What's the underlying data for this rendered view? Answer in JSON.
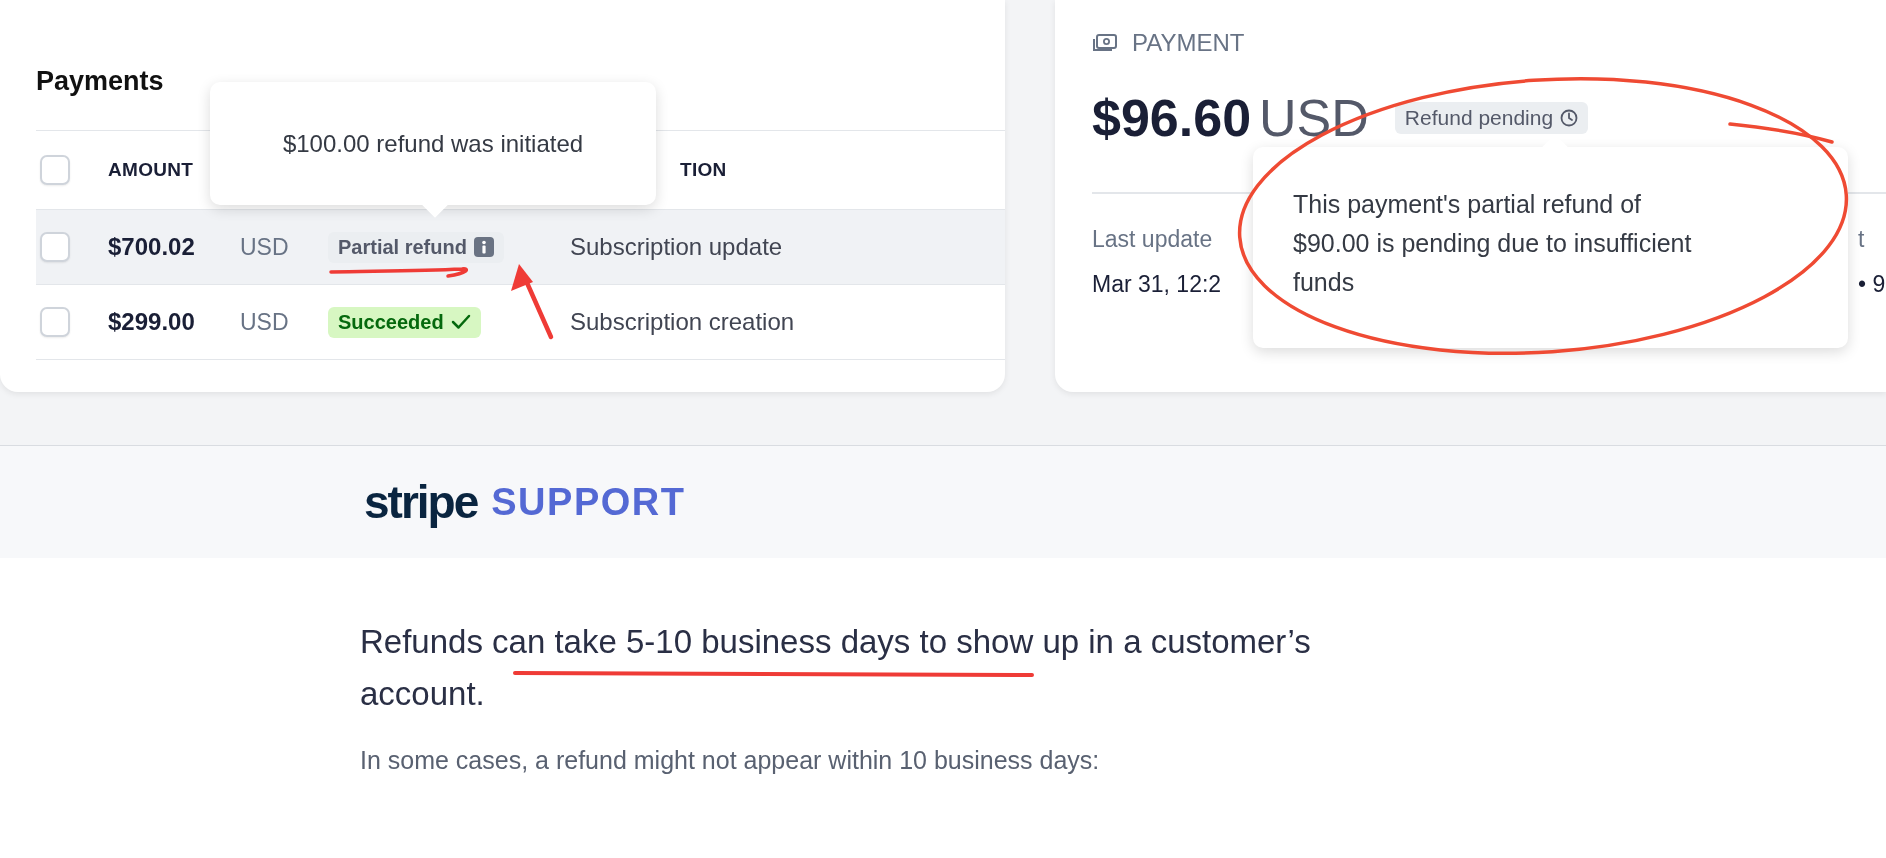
{
  "payments_panel": {
    "title": "Payments",
    "header_checkbox": {
      "checked": false
    },
    "columns": [
      "AMOUNT",
      "TION"
    ],
    "rows": [
      {
        "checked": false,
        "hovered": true,
        "amount": "$700.02",
        "currency": "USD",
        "status": {
          "kind": "partial_refund",
          "label": "Partial refund"
        },
        "description": "Subscription update"
      },
      {
        "checked": false,
        "hovered": false,
        "amount": "$299.00",
        "currency": "USD",
        "status": {
          "kind": "succeeded",
          "label": "Succeeded"
        },
        "description": "Subscription creation"
      }
    ],
    "tooltip": {
      "text": "$100.00 refund was initiated"
    }
  },
  "payment_panel": {
    "label": "PAYMENT",
    "amount": "$96.60",
    "currency": "USD",
    "status": {
      "kind": "pending",
      "label": "Refund pending"
    },
    "meta": [
      {
        "label": "Last update",
        "value": "Mar 31, 12:2"
      },
      {
        "label": "t",
        "value": "• 9"
      }
    ],
    "tooltip": {
      "text": "This payment's partial refund of $90.00 is pending due to insufficient funds"
    }
  },
  "support_page": {
    "logo": "stripe",
    "section": "SUPPORT",
    "lead": "Refunds can take 5-10 business days to show up in a customer’s account.",
    "note": "In some cases, a refund might not appear within 10 business days:"
  }
}
